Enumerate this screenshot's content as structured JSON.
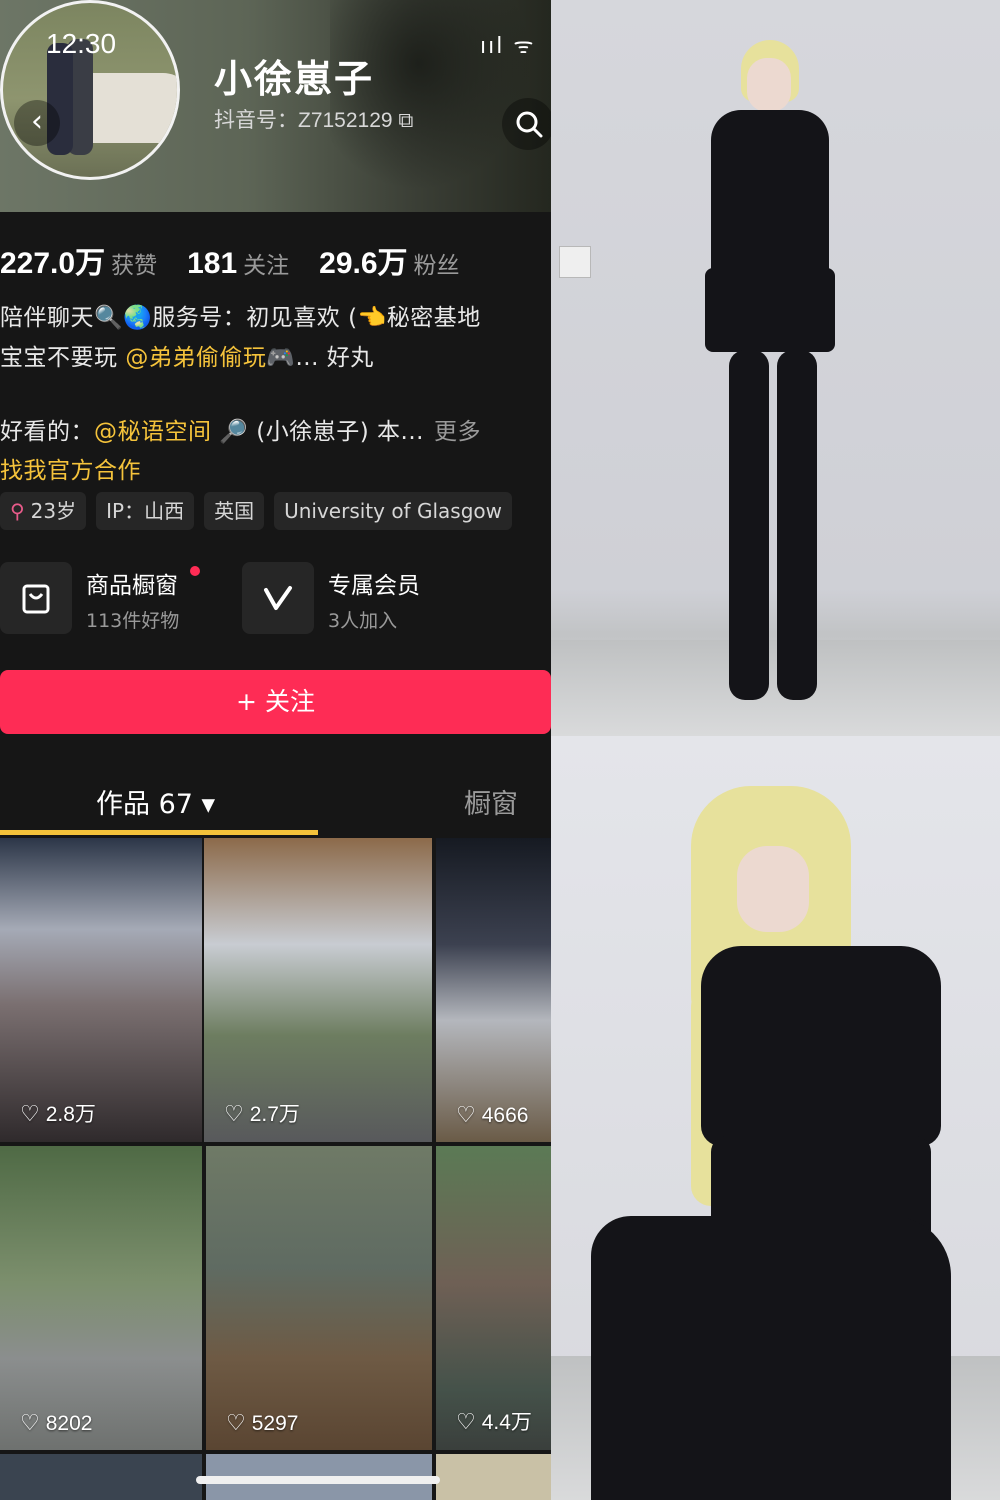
{
  "status_bar": {
    "time": "12:30",
    "icons": "ııl ᯤ"
  },
  "profile": {
    "back_icon": "‹",
    "username": "小徐崽子",
    "account_id": "抖音号：Z7152129 ⧉"
  },
  "stats": [
    {
      "value": "227.0万",
      "label": "获赞"
    },
    {
      "value": "181",
      "label": "关注"
    },
    {
      "value": "29.6万",
      "label": "粉丝"
    }
  ],
  "bio": {
    "line1": "陪伴聊天🔍🌏服务号：初见喜欢 (👈秘密基地",
    "line2_prefix": "宝宝不要玩 ",
    "line2_mention": "@弟弟偷偷玩",
    "line2_suffix": "🎮... 好丸",
    "line3_prefix": "好看的：",
    "line3_mention": "@秘语空间",
    "line3_suffix": " 🔎 (小徐崽子) 本...",
    "more": "更多",
    "line4": "找我官方合作"
  },
  "tags": {
    "age_icon": "⚲",
    "age": "23岁",
    "ip": "IP：山西",
    "country": "英国",
    "school": "University of Glasgow"
  },
  "entries": {
    "shop_title": "商品橱窗",
    "shop_sub": "113件好物",
    "member_title": "专属会员",
    "member_sub": "3人加入"
  },
  "follow_button": "+ 关注",
  "tabs": {
    "works": "作品 67 ▾",
    "shop": "橱窗"
  },
  "videos": [
    {
      "likes": "2.8万"
    },
    {
      "likes": "2.7万"
    },
    {
      "likes": "4666"
    },
    {
      "likes": "8202"
    },
    {
      "likes": "5297"
    },
    {
      "likes": "4.4万"
    }
  ],
  "colors": {
    "accent_red": "#fe2c55",
    "mention_yellow": "#f5c33b",
    "background": "#161616"
  }
}
